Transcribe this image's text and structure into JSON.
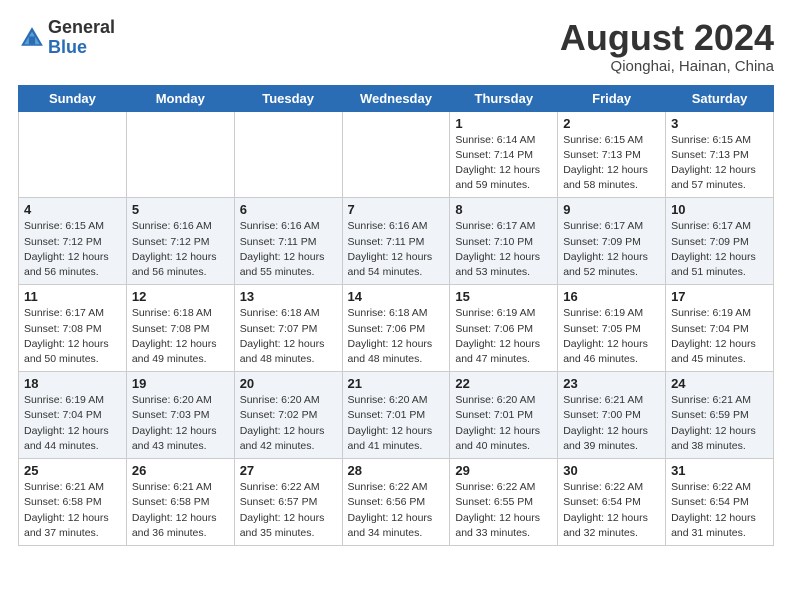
{
  "logo": {
    "general": "General",
    "blue": "Blue"
  },
  "title": "August 2024",
  "subtitle": "Qionghai, Hainan, China",
  "days_of_week": [
    "Sunday",
    "Monday",
    "Tuesday",
    "Wednesday",
    "Thursday",
    "Friday",
    "Saturday"
  ],
  "weeks": [
    [
      {
        "day": "",
        "info": ""
      },
      {
        "day": "",
        "info": ""
      },
      {
        "day": "",
        "info": ""
      },
      {
        "day": "",
        "info": ""
      },
      {
        "day": "1",
        "info": "Sunrise: 6:14 AM\nSunset: 7:14 PM\nDaylight: 12 hours\nand 59 minutes."
      },
      {
        "day": "2",
        "info": "Sunrise: 6:15 AM\nSunset: 7:13 PM\nDaylight: 12 hours\nand 58 minutes."
      },
      {
        "day": "3",
        "info": "Sunrise: 6:15 AM\nSunset: 7:13 PM\nDaylight: 12 hours\nand 57 minutes."
      }
    ],
    [
      {
        "day": "4",
        "info": "Sunrise: 6:15 AM\nSunset: 7:12 PM\nDaylight: 12 hours\nand 56 minutes."
      },
      {
        "day": "5",
        "info": "Sunrise: 6:16 AM\nSunset: 7:12 PM\nDaylight: 12 hours\nand 56 minutes."
      },
      {
        "day": "6",
        "info": "Sunrise: 6:16 AM\nSunset: 7:11 PM\nDaylight: 12 hours\nand 55 minutes."
      },
      {
        "day": "7",
        "info": "Sunrise: 6:16 AM\nSunset: 7:11 PM\nDaylight: 12 hours\nand 54 minutes."
      },
      {
        "day": "8",
        "info": "Sunrise: 6:17 AM\nSunset: 7:10 PM\nDaylight: 12 hours\nand 53 minutes."
      },
      {
        "day": "9",
        "info": "Sunrise: 6:17 AM\nSunset: 7:09 PM\nDaylight: 12 hours\nand 52 minutes."
      },
      {
        "day": "10",
        "info": "Sunrise: 6:17 AM\nSunset: 7:09 PM\nDaylight: 12 hours\nand 51 minutes."
      }
    ],
    [
      {
        "day": "11",
        "info": "Sunrise: 6:17 AM\nSunset: 7:08 PM\nDaylight: 12 hours\nand 50 minutes."
      },
      {
        "day": "12",
        "info": "Sunrise: 6:18 AM\nSunset: 7:08 PM\nDaylight: 12 hours\nand 49 minutes."
      },
      {
        "day": "13",
        "info": "Sunrise: 6:18 AM\nSunset: 7:07 PM\nDaylight: 12 hours\nand 48 minutes."
      },
      {
        "day": "14",
        "info": "Sunrise: 6:18 AM\nSunset: 7:06 PM\nDaylight: 12 hours\nand 48 minutes."
      },
      {
        "day": "15",
        "info": "Sunrise: 6:19 AM\nSunset: 7:06 PM\nDaylight: 12 hours\nand 47 minutes."
      },
      {
        "day": "16",
        "info": "Sunrise: 6:19 AM\nSunset: 7:05 PM\nDaylight: 12 hours\nand 46 minutes."
      },
      {
        "day": "17",
        "info": "Sunrise: 6:19 AM\nSunset: 7:04 PM\nDaylight: 12 hours\nand 45 minutes."
      }
    ],
    [
      {
        "day": "18",
        "info": "Sunrise: 6:19 AM\nSunset: 7:04 PM\nDaylight: 12 hours\nand 44 minutes."
      },
      {
        "day": "19",
        "info": "Sunrise: 6:20 AM\nSunset: 7:03 PM\nDaylight: 12 hours\nand 43 minutes."
      },
      {
        "day": "20",
        "info": "Sunrise: 6:20 AM\nSunset: 7:02 PM\nDaylight: 12 hours\nand 42 minutes."
      },
      {
        "day": "21",
        "info": "Sunrise: 6:20 AM\nSunset: 7:01 PM\nDaylight: 12 hours\nand 41 minutes."
      },
      {
        "day": "22",
        "info": "Sunrise: 6:20 AM\nSunset: 7:01 PM\nDaylight: 12 hours\nand 40 minutes."
      },
      {
        "day": "23",
        "info": "Sunrise: 6:21 AM\nSunset: 7:00 PM\nDaylight: 12 hours\nand 39 minutes."
      },
      {
        "day": "24",
        "info": "Sunrise: 6:21 AM\nSunset: 6:59 PM\nDaylight: 12 hours\nand 38 minutes."
      }
    ],
    [
      {
        "day": "25",
        "info": "Sunrise: 6:21 AM\nSunset: 6:58 PM\nDaylight: 12 hours\nand 37 minutes."
      },
      {
        "day": "26",
        "info": "Sunrise: 6:21 AM\nSunset: 6:58 PM\nDaylight: 12 hours\nand 36 minutes."
      },
      {
        "day": "27",
        "info": "Sunrise: 6:22 AM\nSunset: 6:57 PM\nDaylight: 12 hours\nand 35 minutes."
      },
      {
        "day": "28",
        "info": "Sunrise: 6:22 AM\nSunset: 6:56 PM\nDaylight: 12 hours\nand 34 minutes."
      },
      {
        "day": "29",
        "info": "Sunrise: 6:22 AM\nSunset: 6:55 PM\nDaylight: 12 hours\nand 33 minutes."
      },
      {
        "day": "30",
        "info": "Sunrise: 6:22 AM\nSunset: 6:54 PM\nDaylight: 12 hours\nand 32 minutes."
      },
      {
        "day": "31",
        "info": "Sunrise: 6:22 AM\nSunset: 6:54 PM\nDaylight: 12 hours\nand 31 minutes."
      }
    ]
  ]
}
